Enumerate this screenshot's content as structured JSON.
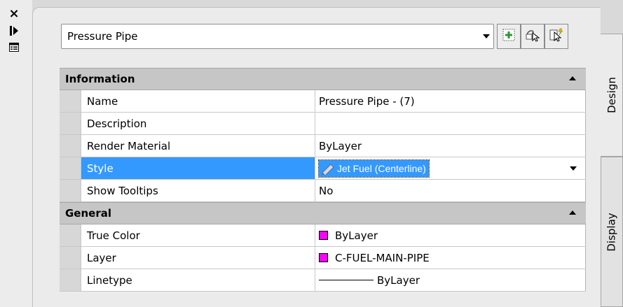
{
  "toolbar": {
    "close_icon": "close-icon",
    "autohide_icon": "autohide-icon",
    "properties_icon": "properties-icon"
  },
  "object_selector": {
    "selected": "Pressure Pipe"
  },
  "tool_buttons": [
    {
      "icon": "toggle-pickadd-icon"
    },
    {
      "icon": "select-objects-icon"
    },
    {
      "icon": "quick-select-icon"
    }
  ],
  "sections": {
    "information": {
      "title": "Information",
      "rows": [
        {
          "label": "Name",
          "value": "Pressure Pipe - (7)"
        },
        {
          "label": "Description",
          "value": ""
        },
        {
          "label": "Render Material",
          "value": "ByLayer"
        },
        {
          "label": "Style",
          "value": "Jet Fuel (Centerline)"
        },
        {
          "label": "Show Tooltips",
          "value": "No"
        }
      ]
    },
    "general": {
      "title": "General",
      "rows": [
        {
          "label": "True Color",
          "value": "ByLayer",
          "swatch": "#ff00ff"
        },
        {
          "label": "Layer",
          "value": "C-FUEL-MAIN-PIPE",
          "swatch": "#ff00ff"
        },
        {
          "label": "Linetype",
          "value": "ByLayer"
        }
      ]
    }
  },
  "tabs": {
    "design": "Design",
    "display": "Display"
  },
  "colors": {
    "selection": "#3399ff",
    "swatch": "#ff00ff"
  }
}
